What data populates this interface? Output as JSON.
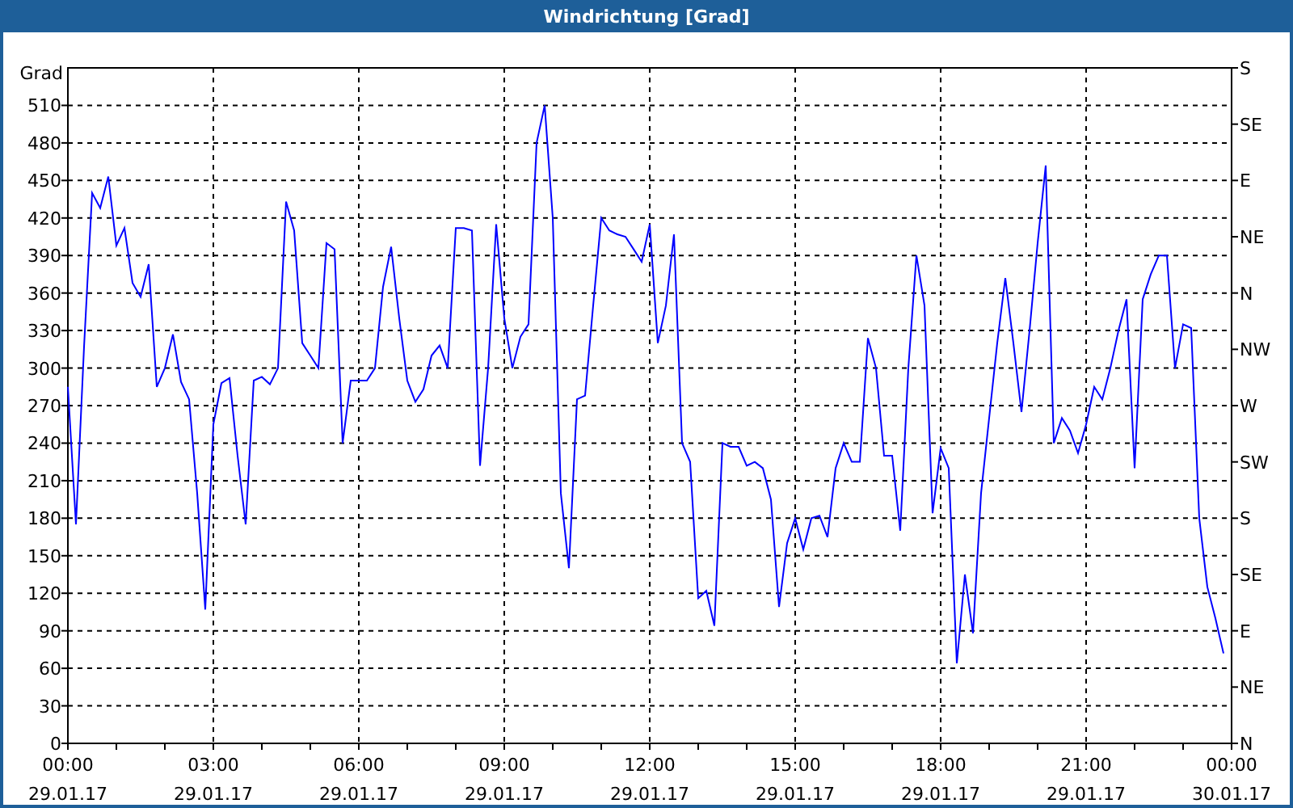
{
  "window": {
    "title": "Windrichtung [Grad]"
  },
  "chart": {
    "chart_data": {
      "type": "line",
      "ylabel": "Grad",
      "categories": [
        "00:00 29.01.17",
        null,
        null,
        null,
        null,
        null,
        null,
        null,
        null,
        null,
        null,
        null,
        null,
        null,
        null,
        null,
        null,
        null,
        "03:00 29.01.17",
        null,
        null,
        null,
        null,
        null,
        null,
        null,
        null,
        null,
        null,
        null,
        null,
        null,
        null,
        null,
        null,
        null,
        "06:00 29.01.17",
        null,
        null,
        null,
        null,
        null,
        null,
        null,
        null,
        null,
        null,
        null,
        null,
        null,
        null,
        null,
        null,
        null,
        "09:00 29.01.17",
        null,
        null,
        null,
        null,
        null,
        null,
        null,
        null,
        null,
        null,
        null,
        null,
        null,
        null,
        null,
        null,
        null,
        "12:00 29.01.17",
        null,
        null,
        null,
        null,
        null,
        null,
        null,
        null,
        null,
        null,
        null,
        null,
        null,
        null,
        null,
        null,
        null,
        "15:00 29.01.17",
        null,
        null,
        null,
        null,
        null,
        null,
        null,
        null,
        null,
        null,
        null,
        null,
        null,
        null,
        null,
        null,
        null,
        "18:00 29.01.17",
        null,
        null,
        null,
        null,
        null,
        null,
        null,
        null,
        null,
        null,
        null,
        null,
        null,
        null,
        null,
        null,
        null,
        "21:00 29.01.17",
        null,
        null,
        null,
        null,
        null,
        null,
        null,
        null,
        null,
        null,
        null,
        null,
        null,
        null,
        null,
        null,
        null,
        "00:00 30.01.17"
      ],
      "series": [
        {
          "color": "#0000ff",
          "values": [
            285,
            175,
            317,
            440,
            428,
            453,
            398,
            412,
            368,
            357,
            383,
            285,
            300,
            327,
            289,
            275,
            200,
            107,
            255,
            288,
            292,
            230,
            175,
            290,
            293,
            287,
            300,
            433,
            410,
            320,
            310,
            300,
            400,
            395,
            240,
            290,
            290,
            290,
            300,
            365,
            397,
            340,
            290,
            273,
            283,
            310,
            318,
            300,
            412,
            412,
            410,
            222,
            300,
            415,
            340,
            300,
            325,
            335,
            480,
            510,
            420,
            200,
            140,
            275,
            278,
            350,
            420,
            410,
            407,
            405,
            395,
            385,
            415,
            320,
            350,
            407,
            240,
            225,
            116,
            122,
            94,
            240,
            237,
            237,
            222,
            225,
            220,
            195,
            109,
            160,
            180,
            155,
            180,
            182,
            165,
            220,
            240,
            225,
            225,
            324,
            300,
            230,
            230,
            170,
            300,
            390,
            350,
            184,
            236,
            220,
            64,
            135,
            88,
            200,
            260,
            320,
            372,
            320,
            265,
            330,
            400,
            462,
            240,
            260,
            250,
            232,
            255,
            285,
            275,
            300,
            330,
            355,
            220,
            355,
            375,
            390,
            390,
            300,
            335,
            332,
            180,
            125,
            100,
            72,
            null
          ]
        }
      ],
      "ylim": [
        0,
        540
      ],
      "grid": true,
      "yticks": [
        0,
        30,
        60,
        90,
        120,
        150,
        180,
        210,
        240,
        270,
        300,
        330,
        360,
        390,
        420,
        450,
        480,
        510
      ]
    },
    "right_axis_labels": [
      "S",
      "SE",
      "E",
      "NE",
      "N",
      "NW",
      "W",
      "SW",
      "S",
      "SE",
      "E",
      "NE",
      "N"
    ]
  }
}
